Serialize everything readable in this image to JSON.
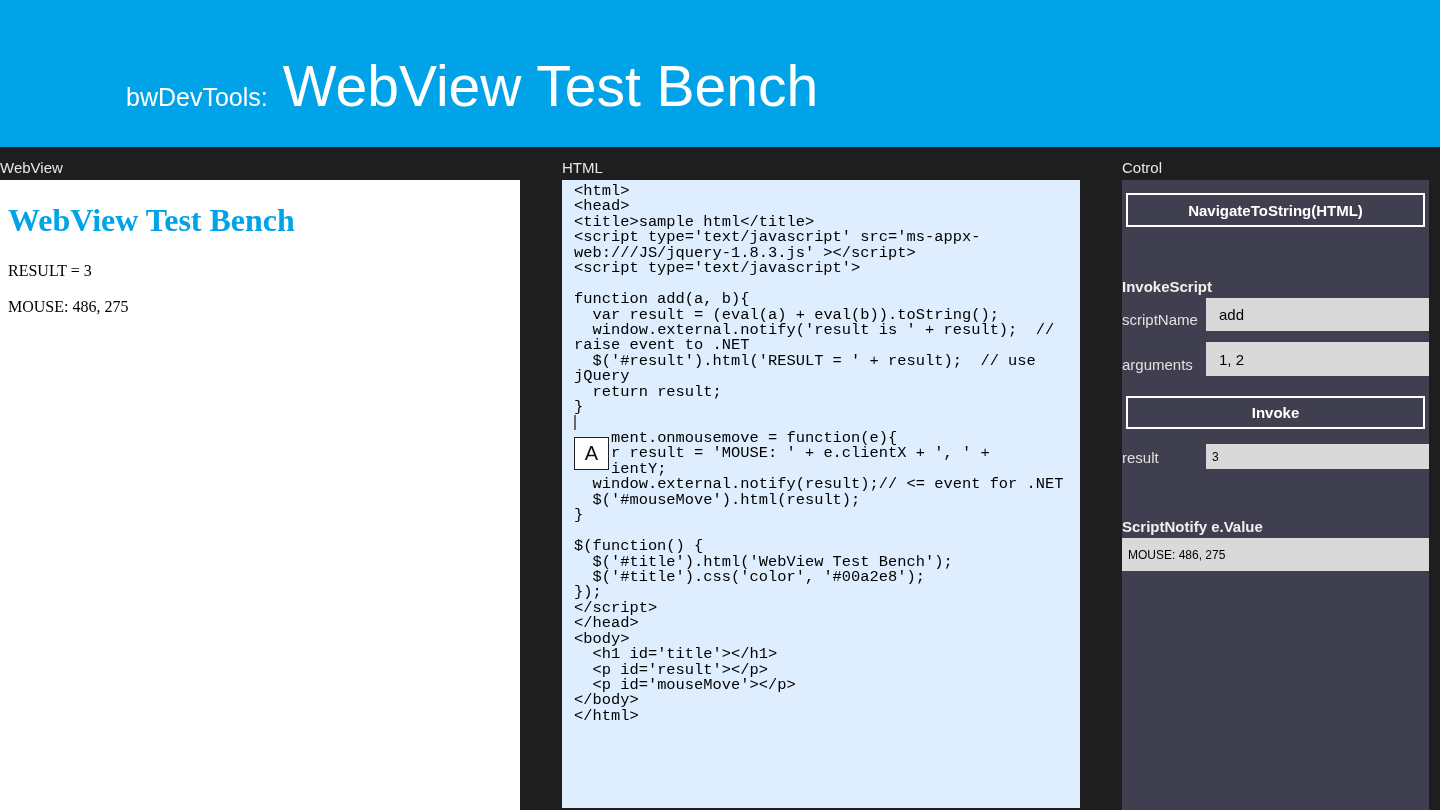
{
  "header": {
    "prefix": "bwDevTools:",
    "title": "WebView Test Bench"
  },
  "webview": {
    "label": "WebView",
    "heading": "WebView Test Bench",
    "paragraphs": [
      "RESULT = 3",
      "MOUSE: 486, 275"
    ]
  },
  "html_editor": {
    "label": "HTML",
    "code": "<html>\n<head>\n<title>sample html</title>\n<script type='text/javascript' src='ms-appx-\nweb:///JS/jquery-1.8.3.js' ></script>\n<script type='text/javascript'>\n\nfunction add(a, b){\n  var result = (eval(a) + eval(b)).toString();\n  window.external.notify('result is ' + result);  //\nraise event to .NET\n  $('#result').html('RESULT = ' + result);  // use\njQuery\n  return result;\n}\n\n    ment.onmousemove = function(e){\n    r result = 'MOUSE: ' + e.clientX + ', ' +\n    ientY;\n  window.external.notify(result);// <= event for .NET\n  $('#mouseMove').html(result);\n}\n\n$(function() {\n  $('#title').html('WebView Test Bench');\n  $('#title').css('color', '#00a2e8');\n});\n</script>\n</head>\n<body>\n  <h1 id='title'></h1>\n  <p id='result'></p>\n  <p id='mouseMove'></p>\n</body>\n</html>",
    "input_mode": "A"
  },
  "control": {
    "label": "Cotrol",
    "navigate_button": "NavigateToString(HTML)",
    "invoke_script": {
      "heading": "InvokeScript",
      "fields": [
        {
          "label": "scriptName",
          "value": "add"
        },
        {
          "label": "arguments",
          "value": "1, 2"
        }
      ],
      "button": "Invoke",
      "result": {
        "label": "result",
        "value": "3"
      }
    },
    "script_notify": {
      "heading": "ScriptNotify e.Value",
      "value": "MOUSE: 486, 275"
    }
  }
}
